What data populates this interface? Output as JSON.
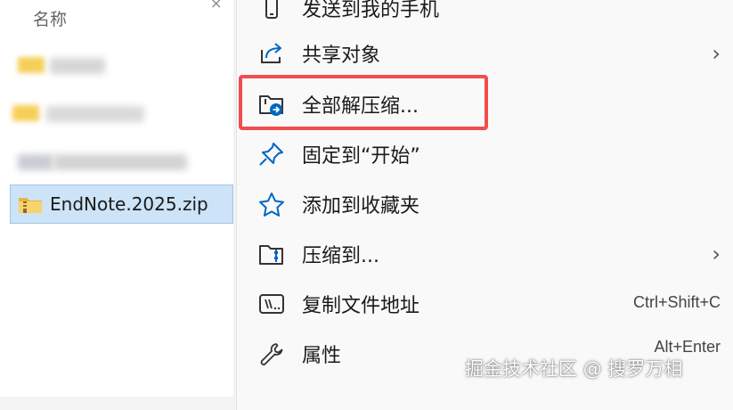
{
  "file_pane": {
    "column_header": "名称",
    "close_glyph": "×",
    "selected_file": "EndNote.2025.zip"
  },
  "menu": {
    "items": [
      {
        "label": "发送到我的手机",
        "icon": "phone-icon"
      },
      {
        "label": "共享对象",
        "icon": "share-icon",
        "submenu": true
      },
      {
        "label": "全部解压缩...",
        "icon": "extract-all-icon",
        "highlighted": true
      },
      {
        "label": "固定到“开始”",
        "icon": "pin-icon"
      },
      {
        "label": "添加到收藏夹",
        "icon": "star-icon"
      },
      {
        "label": "压缩到...",
        "icon": "compress-icon",
        "submenu": true
      },
      {
        "label": "复制文件地址",
        "icon": "copy-path-icon",
        "shortcut": "Ctrl+Shift+C"
      },
      {
        "label": "属性",
        "icon": "wrench-icon",
        "shortcut": "Alt+Enter"
      }
    ],
    "submenu_glyph": "›"
  },
  "accent_color": "#0067c0",
  "highlight_color": "#f04d4d",
  "watermark": "掘金技术社区 @ 搜罗万相"
}
